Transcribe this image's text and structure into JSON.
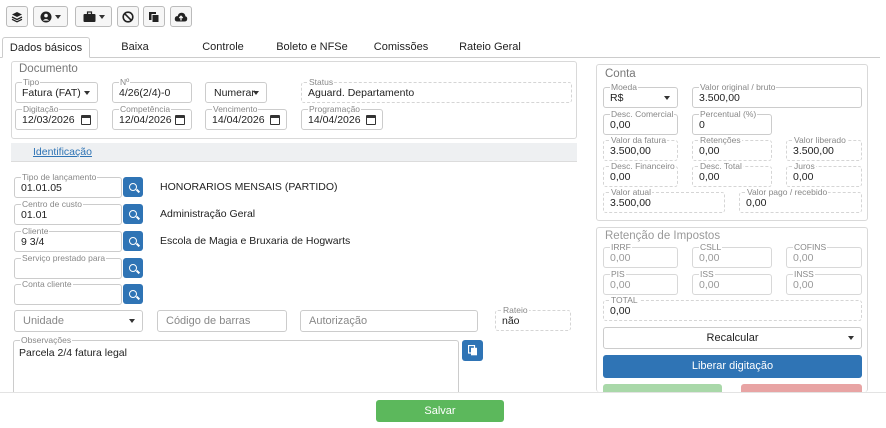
{
  "tabs": [
    "Dados básicos",
    "Baixa",
    "Controle",
    "Boleto e NFSe",
    "Comissões",
    "Rateio Geral"
  ],
  "documento": {
    "legend": "Documento",
    "tipo": {
      "label": "Tipo",
      "value": "Fatura (FAT)"
    },
    "numero": {
      "label": "Nº",
      "value": "4/26(2/4)-0"
    },
    "numerar": "Numerar",
    "status": {
      "label": "Status",
      "value": "Aguard. Departamento"
    },
    "digitacao": {
      "label": "Digitação",
      "value": "12/03/2026"
    },
    "competencia": {
      "label": "Competência",
      "value": "12/04/2026"
    },
    "vencimento": {
      "label": "Vencimento",
      "value": "14/04/2026"
    },
    "programacao": {
      "label": "Programação",
      "value": "14/04/2026"
    }
  },
  "identificacao": "Identificação",
  "ident": {
    "tipo_lancamento": {
      "label": "Tipo de lançamento",
      "value": "01.01.05",
      "desc": "HONORARIOS MENSAIS (PARTIDO)"
    },
    "centro_custo": {
      "label": "Centro de custo",
      "value": "01.01",
      "desc": "Administração Geral"
    },
    "cliente": {
      "label": "Cliente",
      "value": "9 3/4",
      "desc": "Escola de Magia e Bruxaria de Hogwarts"
    },
    "servico": {
      "label": "Serviço prestado para",
      "value": ""
    },
    "conta_cliente": {
      "label": "Conta cliente",
      "value": ""
    },
    "unidade_ph": "Unidade",
    "codigo_barras_ph": "Código de barras",
    "autorizacao_ph": "Autorização",
    "rateio": {
      "label": "Rateio",
      "value": "não"
    },
    "observacoes": {
      "label": "Observações",
      "value": "Parcela 2/4 fatura legal"
    }
  },
  "conta": {
    "legend": "Conta",
    "moeda": {
      "label": "Moeda",
      "value": "R$"
    },
    "valor_original": {
      "label": "Valor original / bruto",
      "value": "3.500,00"
    },
    "desc_comercial": {
      "label": "Desc. Comercial",
      "value": "0,00"
    },
    "percentual": {
      "label": "Percentual (%)",
      "value": "0"
    },
    "valor_fatura": {
      "label": "Valor da fatura",
      "value": "3.500,00"
    },
    "retencoes": {
      "label": "Retenções",
      "value": "0,00"
    },
    "valor_liberado": {
      "label": "Valor liberado",
      "value": "3.500,00"
    },
    "desc_financeiro": {
      "label": "Desc. Financeiro",
      "value": "0,00"
    },
    "desc_total": {
      "label": "Desc. Total",
      "value": "0,00"
    },
    "juros": {
      "label": "Juros",
      "value": "0,00"
    },
    "valor_atual": {
      "label": "Valor atual",
      "value": "3.500,00"
    },
    "valor_pago": {
      "label": "Valor pago / recebido",
      "value": "0,00"
    }
  },
  "retencao": {
    "legend": "Retenção de Impostos",
    "irrf": {
      "label": "IRRF",
      "value": "0,00"
    },
    "csll": {
      "label": "CSLL",
      "value": "0,00"
    },
    "cofins": {
      "label": "COFINS",
      "value": "0,00"
    },
    "pis": {
      "label": "PIS",
      "value": "0,00"
    },
    "iss": {
      "label": "ISS",
      "value": "0,00"
    },
    "inss": {
      "label": "INSS",
      "value": "0,00"
    },
    "total": {
      "label": "TOTAL",
      "value": "0,00"
    },
    "recalcular": "Recalcular",
    "liberar": "Liberar digitação"
  },
  "salvar": "Salvar",
  "colors": {
    "primary": "#2f74b5",
    "success": "#5cb85c",
    "success_light": "#a9d8a9",
    "danger_light": "#e8a4a4"
  }
}
